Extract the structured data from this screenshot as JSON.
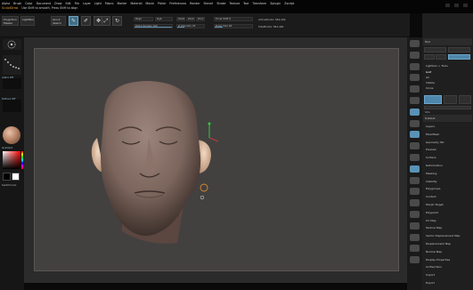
{
  "menu": [
    "Alpha",
    "Brush",
    "Color",
    "Document",
    "Draw",
    "Edit",
    "File",
    "Layer",
    "Light",
    "Macro",
    "Marker",
    "Material",
    "Movie",
    "Picker",
    "Preferences",
    "Render",
    "Stencil",
    "Stroke",
    "Texture",
    "Tool",
    "Transform",
    "Zplugin",
    "Zscript"
  ],
  "status": {
    "tool": "SculptDraw",
    "help": "Use Shift to smooth, Press Shift to align"
  },
  "shelf": {
    "projection_master": "Projection Master",
    "lightbox": "LightBox",
    "quick_sketch": "Quick Sketch",
    "edit": "Edit",
    "draw": "Draw",
    "move": "Move",
    "scale": "Scale",
    "rotate": "Rotate",
    "mrgb": "Mrgb",
    "rgb": "Rgb",
    "m": "M",
    "zadd": "Zadd",
    "zsub": "Zsub",
    "zcut": "Zcut",
    "focal_shift": "Focal Shift 0",
    "draw_size": "Draw Size 64",
    "active_points": "ActivePoints: 584,446",
    "total_points": "TotalPoints: 584,446",
    "z_intensity": "Z Intensity 25",
    "rgb_intensity": "Rgb Intensity 100",
    "draw_size_level": 0.22,
    "z_intensity_level": 0.25,
    "rgb_intensity_level": 1.0
  },
  "left": {
    "brush": "Standard",
    "stroke": "Dots",
    "alpha": "Alpha Off",
    "texture": "Texture Off",
    "material": "MatCap Gray",
    "gradient": "Gradient",
    "switch_color": "SwitchColor"
  },
  "right_tray": {
    "header": "Scroll",
    "subtool_header": "Subtool",
    "tool_header": "Tool",
    "load_tool": "Load Tool",
    "save_as": "Save As",
    "import": "Import",
    "export": "Export",
    "clone": "Clone",
    "make_polymesh": "Make PolyMesh3D",
    "goz": "GoZ",
    "all": "All",
    "visible": "Visible",
    "lightbox_tools": "Lightbox > Tools",
    "sdiv": "SDiv",
    "items": [
      "Layers",
      "FiberMesh",
      "Geometry HD",
      "Preview",
      "Surface",
      "Deformation",
      "Masking",
      "Visibility",
      "Polygroups",
      "Contact",
      "Morph Target",
      "Polypaint",
      "UV Map",
      "Texture Map",
      "Vector Displacement Map",
      "Displacement Map",
      "Normal Map",
      "Display Properties",
      "Unified Skin",
      "Import",
      "Export"
    ]
  },
  "colors": {
    "accent": "#e39b2e",
    "highlight_blue": "#5a92b5",
    "document_bg": "#434040",
    "skin": "#8a7168"
  }
}
